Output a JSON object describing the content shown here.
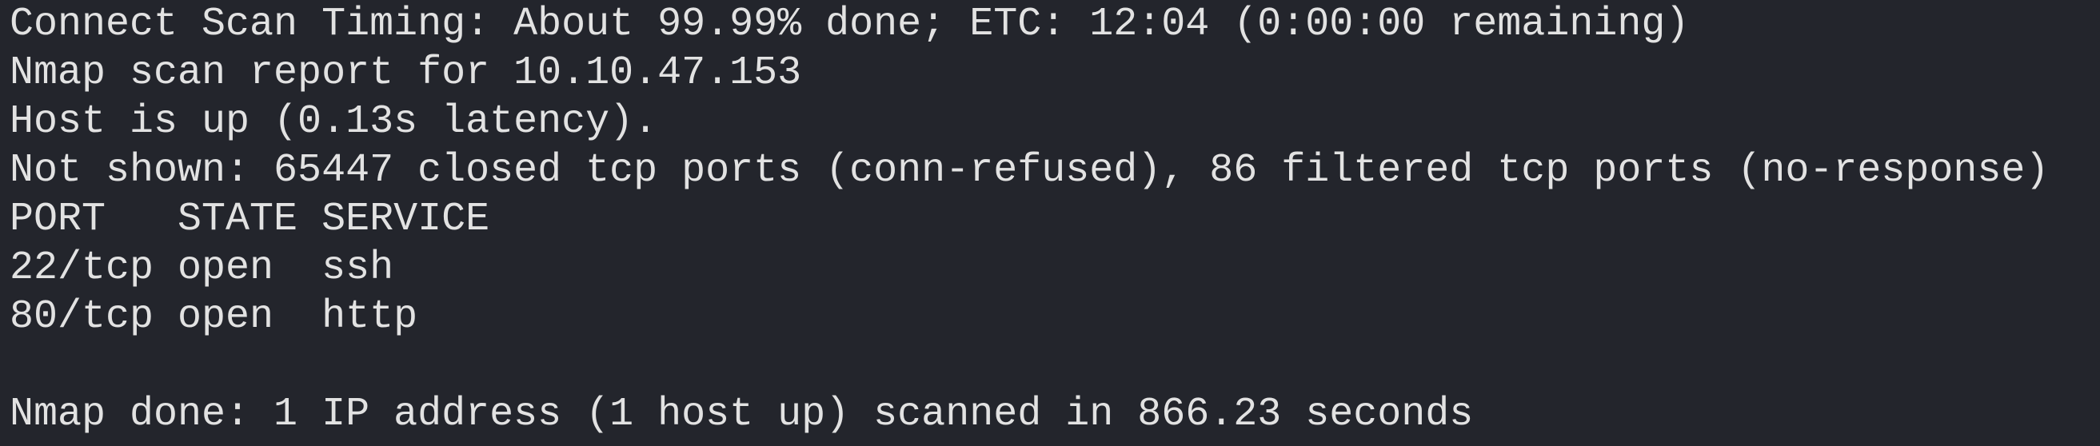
{
  "terminal": {
    "lines": [
      "Connect Scan Timing: About 99.99% done; ETC: 12:04 (0:00:00 remaining)",
      "Nmap scan report for 10.10.47.153",
      "Host is up (0.13s latency).",
      "Not shown: 65447 closed tcp ports (conn-refused), 86 filtered tcp ports (no-response)",
      "PORT   STATE SERVICE",
      "22/tcp open  ssh",
      "80/tcp open  http",
      "",
      "Nmap done: 1 IP address (1 host up) scanned in 866.23 seconds"
    ]
  },
  "colors": {
    "background": "#23252c",
    "text": "#e2e2e2"
  }
}
